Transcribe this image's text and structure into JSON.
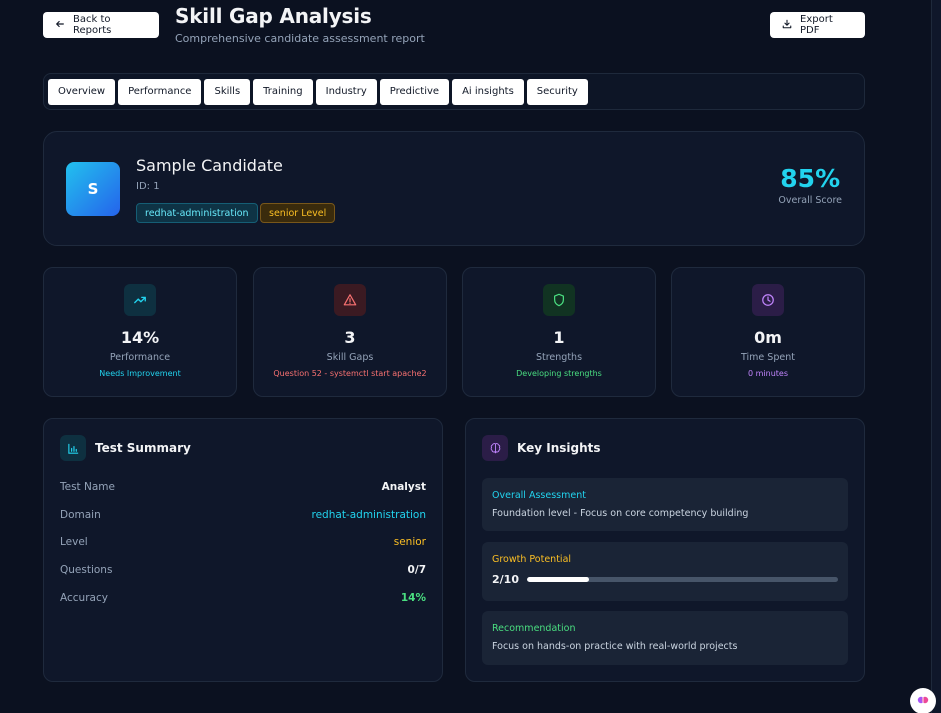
{
  "header": {
    "back_label": "Back to Reports",
    "title": "Skill Gap Analysis",
    "subtitle": "Comprehensive candidate assessment report",
    "export_label": "Export PDF"
  },
  "tabs": [
    "Overview",
    "Performance",
    "Skills",
    "Training",
    "Industry",
    "Predictive",
    "Ai insights",
    "Security"
  ],
  "candidate": {
    "initial": "S",
    "name": "Sample Candidate",
    "id": "ID: 1",
    "domain_badge": "redhat-administration",
    "level_badge": "senior Level",
    "score": "85%",
    "score_label": "Overall Score"
  },
  "stats": [
    {
      "icon": "trending-up-icon",
      "value": "14%",
      "label": "Performance",
      "sub": "Needs Improvement",
      "color": "#22d3ee",
      "bg": "#0e3040"
    },
    {
      "icon": "alert-triangle-icon",
      "value": "3",
      "label": "Skill Gaps",
      "sub": "Question 52 - systemctl start apache2",
      "color": "#f87171",
      "bg": "#3b1a22"
    },
    {
      "icon": "shield-icon",
      "value": "1",
      "label": "Strengths",
      "sub": "Developing strengths",
      "color": "#4ade80",
      "bg": "#113322"
    },
    {
      "icon": "clock-icon",
      "value": "0m",
      "label": "Time Spent",
      "sub": "0 minutes",
      "color": "#c084fc",
      "bg": "#2b1d47"
    }
  ],
  "test_summary": {
    "title": "Test Summary",
    "rows": [
      {
        "key": "Test Name",
        "value": "Analyst",
        "color": "#f3f4f6"
      },
      {
        "key": "Domain",
        "value": "redhat-administration",
        "color": "#22d3ee"
      },
      {
        "key": "Level",
        "value": "senior",
        "color": "#fbbf24"
      },
      {
        "key": "Questions",
        "value": "0/7",
        "color": "#f3f4f6"
      },
      {
        "key": "Accuracy",
        "value": "14%",
        "color": "#4ade80"
      }
    ]
  },
  "key_insights": {
    "title": "Key Insights",
    "overall_title": "Overall Assessment",
    "overall_body": "Foundation level - Focus on core competency building",
    "growth_title": "Growth Potential",
    "growth_value": "2/10",
    "growth_fraction": 0.2,
    "rec_title": "Recommendation",
    "rec_body": "Focus on hands-on practice with real-world projects"
  },
  "colors": {
    "accent": "#22d3ee",
    "overall": "#22d3ee",
    "growth": "#fbbf24",
    "recommendation": "#4ade80"
  }
}
